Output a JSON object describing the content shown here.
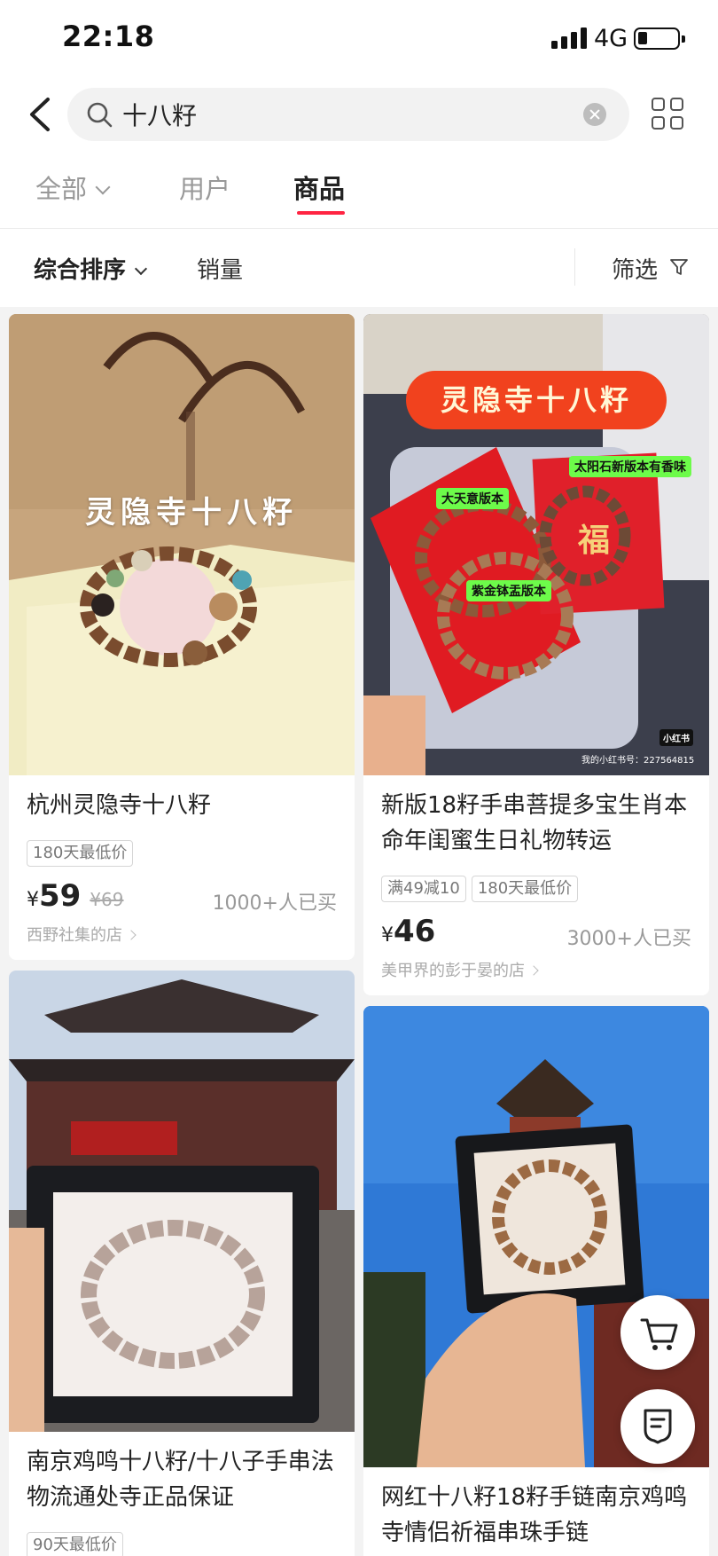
{
  "status_bar": {
    "time": "22:18",
    "network": "4G"
  },
  "search": {
    "query": "十八籽",
    "placeholder": ""
  },
  "tabs": [
    {
      "label": "全部"
    },
    {
      "label": "用户"
    },
    {
      "label": "商品"
    }
  ],
  "active_tab": "商品",
  "filters": {
    "sort_label": "综合排序",
    "sales_label": "销量",
    "filter_label": "筛选"
  },
  "products": [
    {
      "title": "杭州灵隐寺十八籽",
      "tags": [
        "180天最低价"
      ],
      "currency": "¥",
      "price": "59",
      "original_price": "¥69",
      "bought": "1000+人已买",
      "shop": "西野社集的店",
      "image_text": "灵隐寺十八籽"
    },
    {
      "title": "新版18籽手串菩提多宝生肖本命年闺蜜生日礼物转运",
      "tags": [
        "满49减10",
        "180天最低价"
      ],
      "currency": "¥",
      "price": "46",
      "bought": "3000+人已买",
      "shop": "美甲界的彭于晏的店",
      "image_text": "灵隐寺十八籽",
      "image_labels": [
        "太阳石新版本有香味",
        "大天意版本",
        "紫金钵盂版本",
        "福",
        "小红书",
        "我的小红书号：227564815"
      ]
    },
    {
      "title": "南京鸡鸣十八籽/十八子手串法物流通处寺正品保证",
      "tags": [
        "90天最低价"
      ]
    },
    {
      "title": "网红十八籽18籽手链南京鸡鸣寺情侣祈福串珠手链"
    }
  ],
  "colors": {
    "accent": "#ff2442",
    "background": "#f3f3f3"
  }
}
